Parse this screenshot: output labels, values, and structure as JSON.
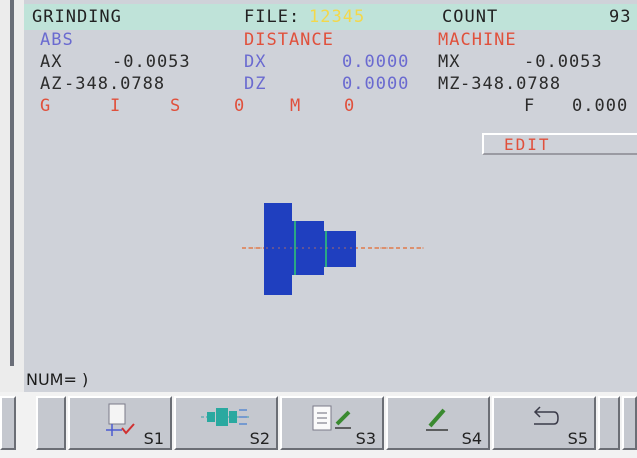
{
  "header": {
    "mode": "GRINDING",
    "file_label": "FILE:",
    "file_value": "12345",
    "count_label": "COUNT",
    "count_value": "93"
  },
  "columns": {
    "abs_title": "ABS",
    "distance_title": "DISTANCE",
    "machine_title": "MACHINE"
  },
  "abs": {
    "ax_label": "AX",
    "ax_value": "-0.0053",
    "az_label": "AZ",
    "az_value": "-348.0788"
  },
  "distance": {
    "dx_label": "DX",
    "dx_value": "0.0000",
    "dz_label": "DZ",
    "dz_value": "0.0000"
  },
  "machine": {
    "mx_label": "MX",
    "mx_value": "-0.0053",
    "mz_label": "MZ",
    "mz_value": "-348.0788"
  },
  "status": {
    "g_label": "G",
    "i_label": "I",
    "s_label": "S",
    "s_value": "0",
    "m_label": "M",
    "m_value": "0",
    "f_label": "F",
    "f_value": "0.000"
  },
  "mode_box": "EDIT",
  "input_line": "NUM= )",
  "softkeys": [
    {
      "label": "S1",
      "icon": "workpiece-coordinate-icon"
    },
    {
      "label": "S2",
      "icon": "wheel-spindle-icon"
    },
    {
      "label": "S3",
      "icon": "document-edit-icon"
    },
    {
      "label": "S4",
      "icon": "pencil-icon"
    },
    {
      "label": "S5",
      "icon": "return-arrow-icon"
    }
  ],
  "colors": {
    "header_bg": "#bfe3d9",
    "screen_bg": "#cfd2d9",
    "part_blue": "#1f3fbf",
    "centerline": "#e07a4a",
    "highlight": "#f3d84a"
  }
}
